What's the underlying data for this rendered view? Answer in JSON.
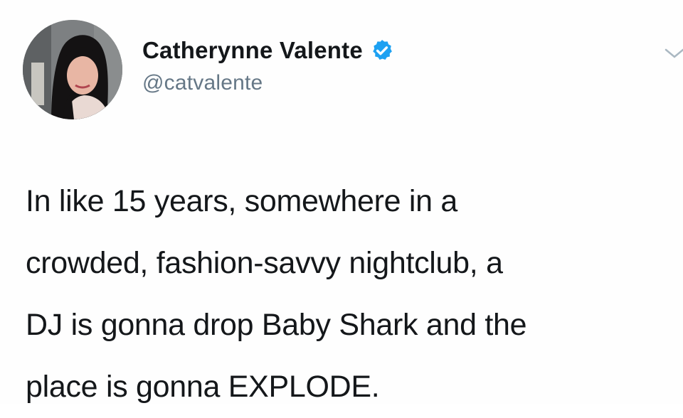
{
  "tweet": {
    "author": {
      "display_name": "Catherynne Valente",
      "handle": "@catvalente",
      "verified": true,
      "avatar_icon": "profile-photo"
    },
    "text": "In like 15 years, somewhere in a\ncrowded, fashion-savvy nightclub, a\nDJ is gonna drop Baby Shark and the\nplace is gonna EXPLODE.",
    "menu_icon": "chevron-down-icon"
  },
  "colors": {
    "text": "#14171a",
    "secondary_text": "#657786",
    "verified_badge": "#1da1f2",
    "background": "#ffffff"
  }
}
